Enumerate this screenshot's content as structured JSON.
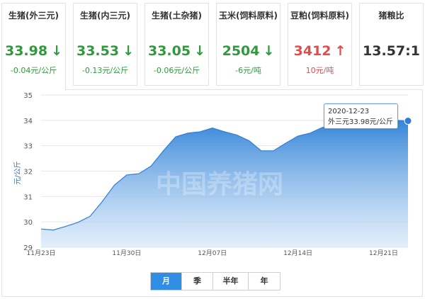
{
  "cards": [
    {
      "name": "生猪(外三元)",
      "price": "33.98",
      "arrow": "↓",
      "change": "-0.04元/公斤",
      "dir": "down"
    },
    {
      "name": "生猪(内三元)",
      "price": "33.53",
      "arrow": "↓",
      "change": "-0.13元/公斤",
      "dir": "down"
    },
    {
      "name": "生猪(土杂猪)",
      "price": "33.05",
      "arrow": "↓",
      "change": "-0.06元/公斤",
      "dir": "down"
    },
    {
      "name": "玉米(饲料原料)",
      "price": "2504",
      "arrow": "↓",
      "change": "-6元/吨",
      "dir": "down"
    },
    {
      "name": "豆粕(饲料原料)",
      "price": "3412",
      "arrow": "↑",
      "change": "10元/吨",
      "dir": "up"
    },
    {
      "name": "猪粮比",
      "price": "13.57:1",
      "arrow": "",
      "change": "",
      "dir": "neutral"
    }
  ],
  "tooltip": {
    "date": "2020-12-23",
    "text": "外三元33.98元/公斤"
  },
  "watermark": "中国养猪网",
  "tabs": [
    "月",
    "季",
    "半年",
    "年"
  ],
  "chart_data": {
    "type": "area",
    "ylabel": "元/公斤",
    "ylim": [
      29,
      35
    ],
    "yticks": [
      29,
      30,
      31,
      32,
      33,
      34,
      35
    ],
    "xticks": [
      "11月23日",
      "11月30日",
      "12月07日",
      "12月14日",
      "12月21日"
    ],
    "x": [
      "11-23",
      "11-24",
      "11-25",
      "11-26",
      "11-27",
      "11-28",
      "11-29",
      "11-30",
      "12-01",
      "12-02",
      "12-03",
      "12-04",
      "12-05",
      "12-06",
      "12-07",
      "12-08",
      "12-09",
      "12-10",
      "12-11",
      "12-12",
      "12-13",
      "12-14",
      "12-15",
      "12-16",
      "12-17",
      "12-18",
      "12-19",
      "12-20",
      "12-21",
      "12-22",
      "12-23"
    ],
    "values": [
      29.72,
      29.68,
      29.82,
      29.98,
      30.22,
      30.8,
      31.45,
      31.85,
      31.9,
      32.2,
      32.8,
      33.35,
      33.5,
      33.55,
      33.7,
      33.55,
      33.42,
      33.2,
      32.8,
      32.8,
      33.1,
      33.38,
      33.5,
      33.72,
      33.85,
      33.95,
      34.0,
      34.0,
      34.0,
      34.0,
      33.98
    ],
    "grid": true,
    "highlight": {
      "x": "12-23",
      "value": 33.98
    }
  }
}
